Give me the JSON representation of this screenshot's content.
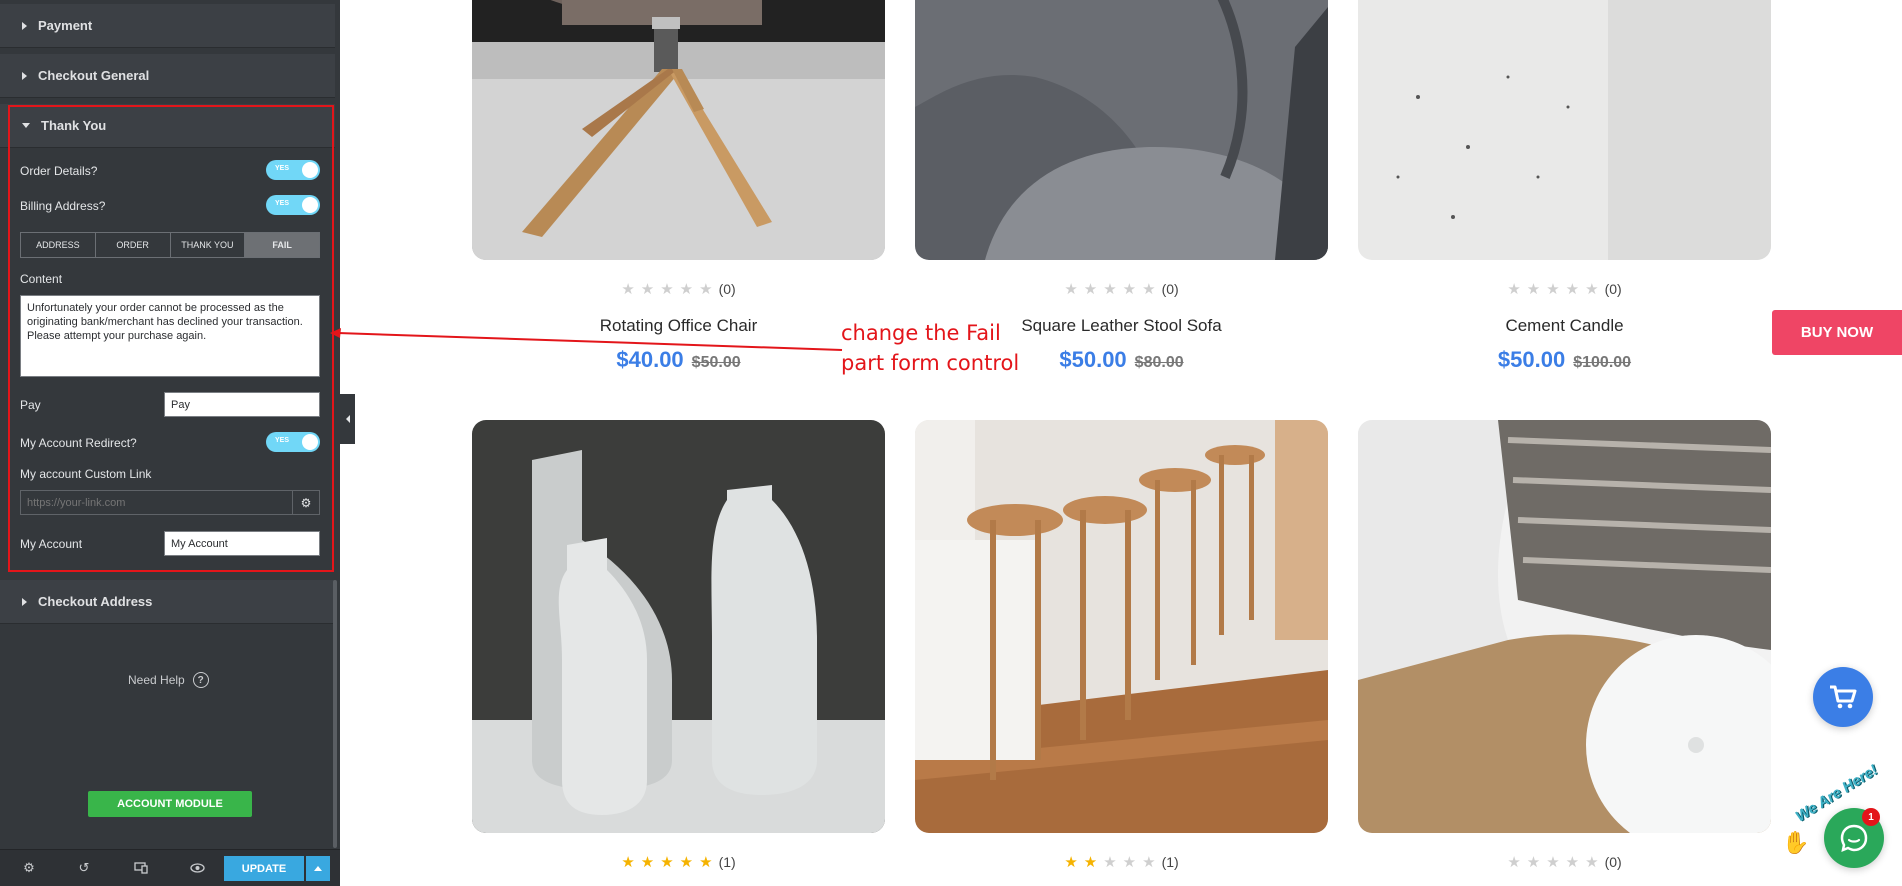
{
  "sidebar": {
    "sections": {
      "payment": "Payment",
      "checkout_general": "Checkout General",
      "thank_you": "Thank You",
      "checkout_address": "Checkout Address"
    },
    "thank_you": {
      "order_details_label": "Order Details?",
      "order_details_toggle": "YES",
      "billing_address_label": "Billing Address?",
      "billing_address_toggle": "YES",
      "tabs": [
        "ADDRESS",
        "ORDER",
        "THANK YOU",
        "FAIL"
      ],
      "active_tab": "FAIL",
      "content_label": "Content",
      "content_value": "Unfortunately your order cannot be processed as the originating bank/merchant has declined your transaction. Please attempt your purchase again.",
      "pay_label": "Pay",
      "pay_value": "Pay",
      "redirect_label": "My Account Redirect?",
      "redirect_toggle": "YES",
      "custom_link_label": "My account Custom Link",
      "custom_link_placeholder": "https://your-link.com",
      "my_account_label": "My Account",
      "my_account_value": "My Account"
    },
    "need_help": "Need Help",
    "account_module": "ACCOUNT MODULE",
    "footer": {
      "update": "UPDATE"
    }
  },
  "annotation": {
    "line1": "change the Fail",
    "line2": "part form control"
  },
  "products": [
    {
      "name": "Rotating Office Chair",
      "price": "$40.00",
      "old_price": "$50.00",
      "rating": 0,
      "reviews": "(0)"
    },
    {
      "name": "Square Leather Stool Sofa",
      "price": "$50.00",
      "old_price": "$80.00",
      "rating": 0,
      "reviews": "(0)"
    },
    {
      "name": "Cement Candle",
      "price": "$50.00",
      "old_price": "$100.00",
      "rating": 0,
      "reviews": "(0)"
    },
    {
      "name": "",
      "price": "",
      "old_price": "",
      "rating": 5,
      "reviews": "(1)"
    },
    {
      "name": "",
      "price": "",
      "old_price": "",
      "rating": 2,
      "reviews": "(1)"
    },
    {
      "name": "",
      "price": "",
      "old_price": "",
      "rating": 0,
      "reviews": "(0)"
    }
  ],
  "buy_now": "BUY NOW",
  "chat": {
    "badge": "1",
    "greeting": "We Are Here!"
  },
  "colors": {
    "accent_blue": "#3b7ee6",
    "buy_now": "#ef4565",
    "highlight_border": "#e3151a",
    "account_module": "#39b54a",
    "update": "#39a8e0",
    "toggle_on": "#71d7f7"
  },
  "icons": {
    "footer": [
      "gear-icon",
      "history-icon",
      "responsive-icon",
      "eye-icon"
    ],
    "cart": "cart-icon",
    "chat": "chat-icon",
    "help": "question-icon"
  }
}
